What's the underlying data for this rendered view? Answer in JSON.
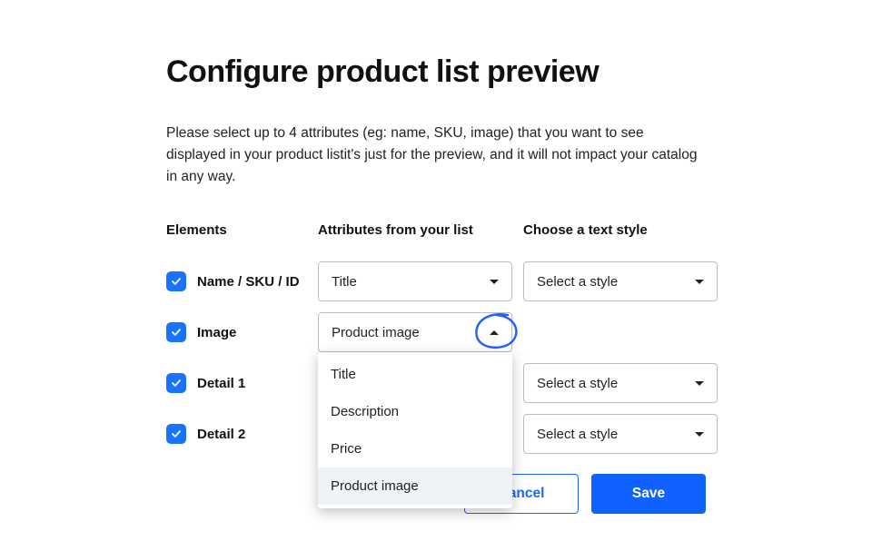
{
  "modal": {
    "title": "Configure product list preview",
    "description": "Please select up to 4 attributes (eg: name, SKU, image) that you want to see displayed in your product listit's just for the preview, and it will not impact your catalog in any way.",
    "headers": {
      "elements": "Elements",
      "attributes": "Attributes from your list",
      "style": "Choose a text style"
    },
    "rows": [
      {
        "checked": true,
        "label": "Name / SKU / ID",
        "attr_value": "Title",
        "style_value": "Select a style",
        "has_style": true,
        "open": false
      },
      {
        "checked": true,
        "label": "Image",
        "attr_value": "Product image",
        "style_value": "",
        "has_style": false,
        "open": true
      },
      {
        "checked": true,
        "label": "Detail 1",
        "attr_value": "",
        "style_value": "Select a style",
        "has_style": true,
        "open": false
      },
      {
        "checked": true,
        "label": "Detail 2",
        "attr_value": "",
        "style_value": "Select a style",
        "has_style": true,
        "open": false
      }
    ],
    "dropdown_options": [
      "Title",
      "Description",
      "Price",
      "Product image"
    ],
    "dropdown_selected": "Product image",
    "buttons": {
      "cancel": "Cancel",
      "save": "Save"
    }
  }
}
